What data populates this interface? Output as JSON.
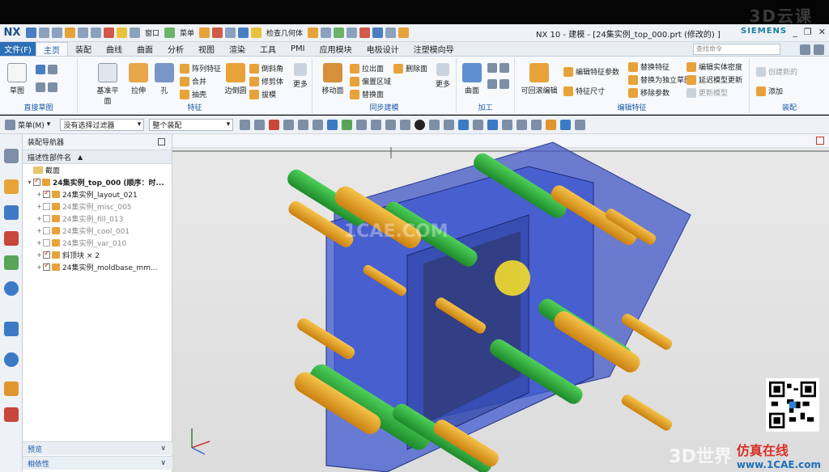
{
  "app": {
    "logo": "NX",
    "window_title": "NX 10 - 建模 - [24集实例_top_000.prt  (修改的) ]",
    "brand": "SIEMENS",
    "top_watermark": "3D云课"
  },
  "quick_access": {
    "items": [
      "窗口",
      "菜单",
      "检查几何体"
    ]
  },
  "tabs": {
    "file": "文件(F)",
    "items": [
      "主页",
      "装配",
      "曲线",
      "曲面",
      "分析",
      "视图",
      "渲染",
      "工具",
      "PMI",
      "应用模块",
      "电极设计",
      "注塑模向导"
    ],
    "active": "主页",
    "search_placeholder": "查找命令"
  },
  "ribbon": {
    "groups": {
      "direct_sketch": "直接草图",
      "feature": "特征",
      "sync_modeling": "同步建模",
      "machining": "加工",
      "edit_feature": "编辑特征",
      "assembly": "装配"
    },
    "buttons": {
      "sketch": "草图",
      "datum_plane": "基准平面",
      "extrude": "拉伸",
      "hole": "孔",
      "pattern_feature": "阵列特征",
      "unite": "合并",
      "shell": "抽壳",
      "edge_blend": "边倒圆",
      "chamfer": "倒斜角",
      "trim_body": "修剪体",
      "draft": "拔模",
      "more1": "更多",
      "move_face": "移动面",
      "pull_face": "拉出面",
      "offset_region": "偏置区域",
      "replace_face": "替换面",
      "delete_face": "删除面",
      "more2": "更多",
      "surface": "曲面",
      "rollback_edit": "可回滚编辑",
      "edit_feature_params": "编辑特征参数",
      "feature_dimension": "特征尺寸",
      "replace_feature": "替换特征",
      "replace_with_sketch": "替换为独立草图",
      "remove_params": "移除参数",
      "edit_solid_density": "编辑实体密度",
      "delay_model_update": "延迟模型更新",
      "update_model": "更新模型",
      "add": "添加",
      "create_new": "创建新的"
    }
  },
  "command_bar": {
    "menu": "菜单(M)",
    "filter": "没有选择过滤器",
    "scope": "整个装配"
  },
  "navigator": {
    "title": "装配导航器",
    "column": "描述性部件名",
    "rows": [
      {
        "label": "截面",
        "level": 0,
        "kind": "folder",
        "dim": false
      },
      {
        "label": "24集实例_top_000 (顺序：时...",
        "level": 0,
        "kind": "assembly",
        "dim": false
      },
      {
        "label": "24集实例_layout_021",
        "level": 1,
        "kind": "part",
        "dim": false
      },
      {
        "label": "24集实例_misc_005",
        "level": 1,
        "kind": "part",
        "dim": true
      },
      {
        "label": "24集实例_fill_013",
        "level": 1,
        "kind": "part",
        "dim": true
      },
      {
        "label": "24集实例_cool_001",
        "level": 1,
        "kind": "part",
        "dim": true
      },
      {
        "label": "24集实例_var_010",
        "level": 1,
        "kind": "part",
        "dim": true
      },
      {
        "label": "斜顶块 × 2",
        "level": 1,
        "kind": "part",
        "dim": false
      },
      {
        "label": "24集实例_moldbase_mm...",
        "level": 1,
        "kind": "part",
        "dim": false
      }
    ],
    "footer": [
      "预览",
      "相依性"
    ]
  },
  "watermarks": {
    "center": "1CAE.COM",
    "bottom_3d": "3D世界",
    "bottom_cn": "仿真在线",
    "bottom_site": "www.1CAE.com"
  },
  "colors": {
    "accent": "#2d6fb7",
    "plate": "#3e57c9",
    "pin_orange": "#e6a22a",
    "pin_green": "#34b54a"
  }
}
